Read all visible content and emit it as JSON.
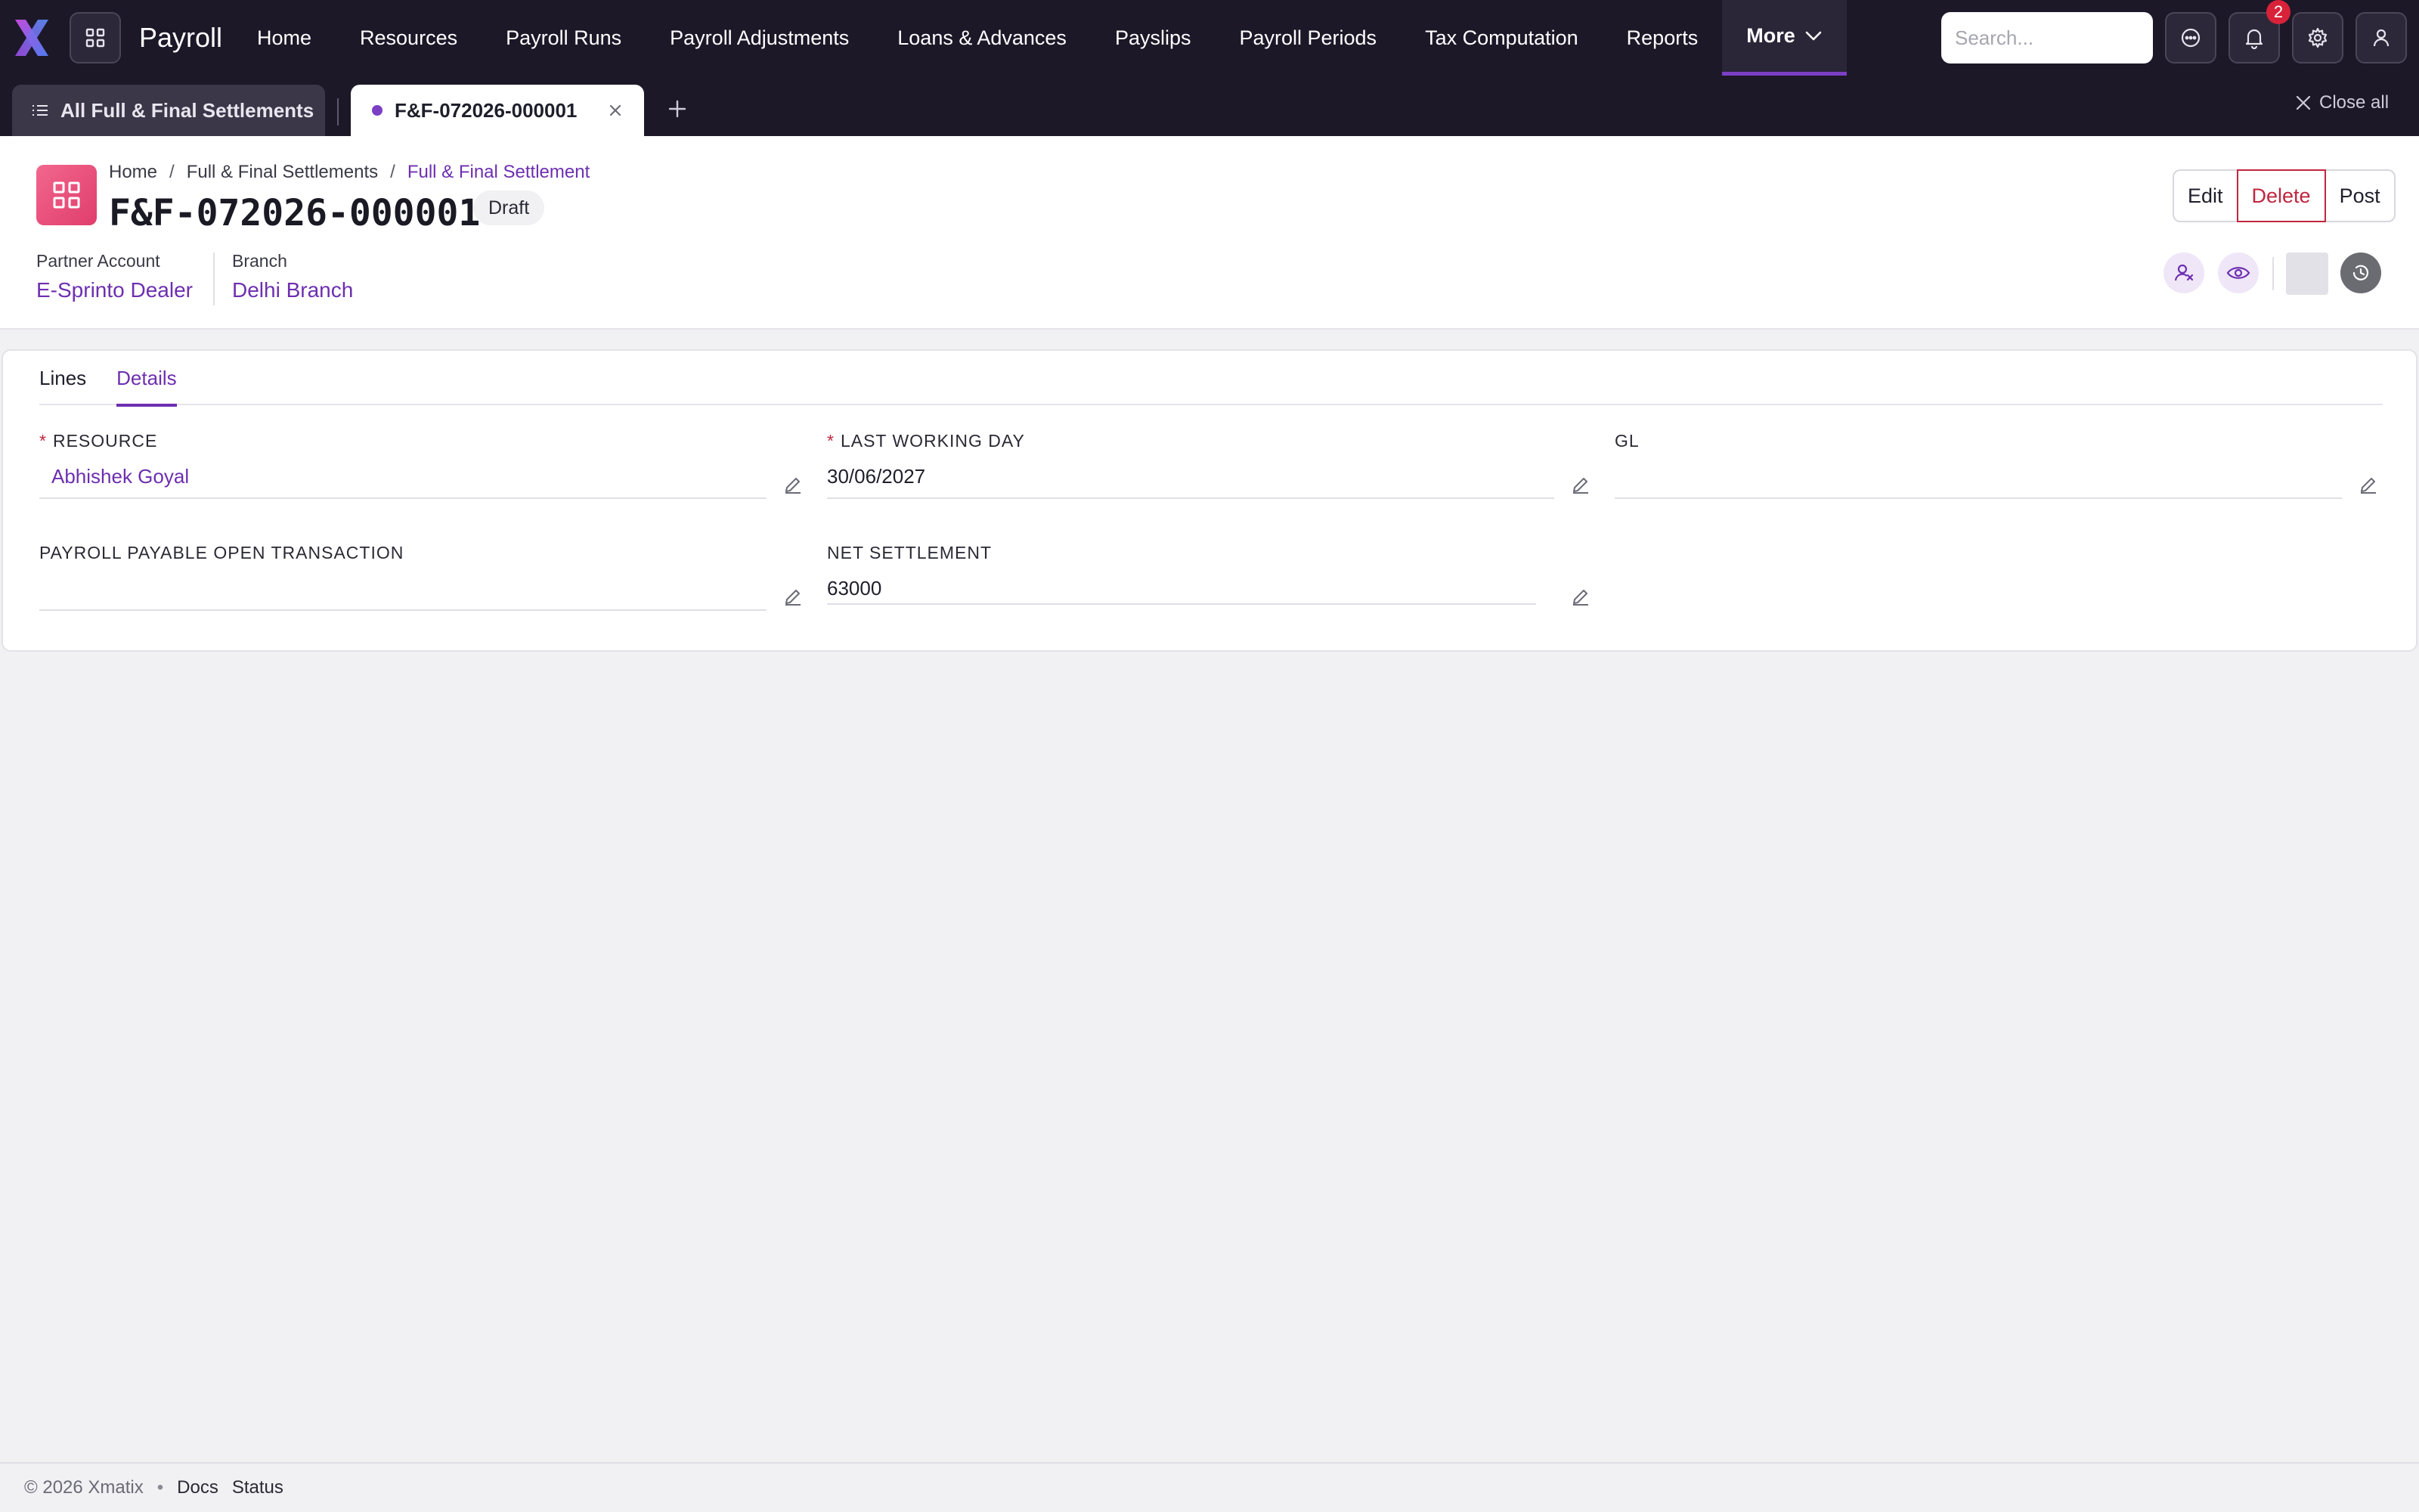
{
  "app": {
    "title": "Payroll"
  },
  "nav": {
    "items": [
      {
        "label": "Home"
      },
      {
        "label": "Resources"
      },
      {
        "label": "Payroll Runs"
      },
      {
        "label": "Payroll Adjustments"
      },
      {
        "label": "Loans & Advances"
      },
      {
        "label": "Payslips"
      },
      {
        "label": "Payroll Periods"
      },
      {
        "label": "Tax Computation"
      },
      {
        "label": "Reports"
      }
    ],
    "more_label": "More"
  },
  "search": {
    "placeholder": "Search..."
  },
  "notifications": {
    "count": "2"
  },
  "tabs": {
    "list_label": "All Full & Final Settlements",
    "active_label": "F&F-072026-000001",
    "close_all_label": "Close all"
  },
  "breadcrumb": {
    "home": "Home",
    "parent": "Full & Final Settlements",
    "current": "Full & Final Settlement"
  },
  "document": {
    "title": "F&F-072026-000001",
    "status": "Draft",
    "partner_label": "Partner Account",
    "partner_value": "E-Sprinto Dealer",
    "branch_label": "Branch",
    "branch_value": "Delhi Branch"
  },
  "actions": {
    "edit": "Edit",
    "delete": "Delete",
    "post": "Post"
  },
  "content_tabs": {
    "lines": "Lines",
    "details": "Details"
  },
  "fields": {
    "resource": {
      "label": "Resource",
      "value": "Abhishek Goyal"
    },
    "last_working_day": {
      "label": "Last Working Day",
      "value": "30/06/2027"
    },
    "gl": {
      "label": "GL",
      "value": ""
    },
    "payroll_payable": {
      "label": "Payroll Payable Open Transaction",
      "value": ""
    },
    "net_settlement": {
      "label": "Net Settlement",
      "value": "63000"
    }
  },
  "footer": {
    "copyright": "© 2026 Xmatix",
    "docs": "Docs",
    "status": "Status"
  },
  "colors": {
    "accent": "#6d2fb0",
    "nav_bg": "#1c1828",
    "danger": "#c0263f",
    "doc_icon": "#e8507a"
  }
}
